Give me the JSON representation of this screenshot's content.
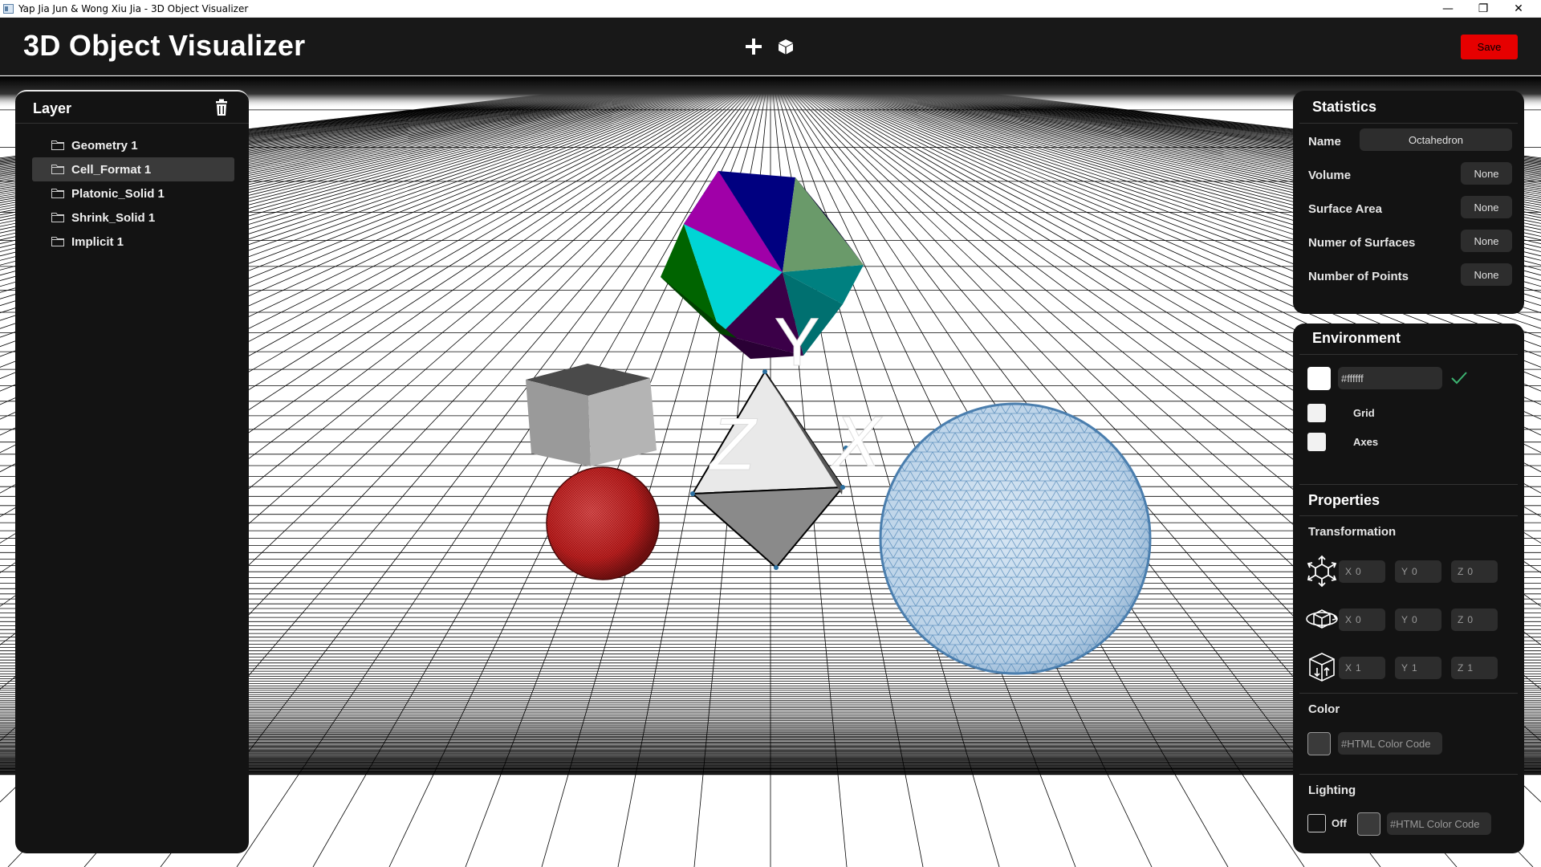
{
  "window": {
    "title": "Yap Jia Jun & Wong Xiu Jia - 3D Object Visualizer",
    "controls": {
      "minimize": "—",
      "maximize": "❐",
      "close": "✕"
    }
  },
  "header": {
    "title": "3D Object Visualizer",
    "icons": [
      "plus-icon",
      "cube-icon"
    ],
    "save_label": "Save",
    "save_color": "#e60000"
  },
  "layer_panel": {
    "title": "Layer",
    "items": [
      {
        "label": "Geometry 1",
        "selected": false
      },
      {
        "label": "Cell_Format 1",
        "selected": true
      },
      {
        "label": "Platonic_Solid 1",
        "selected": false
      },
      {
        "label": "Shrink_Solid 1",
        "selected": false
      },
      {
        "label": "Implicit 1",
        "selected": false
      }
    ]
  },
  "statistics": {
    "title": "Statistics",
    "rows": [
      {
        "label": "Name",
        "value": "Octahedron"
      },
      {
        "label": "Volume",
        "value": "None"
      },
      {
        "label": "Surface Area",
        "value": "None"
      },
      {
        "label": "Numer of Surfaces",
        "value": "None"
      },
      {
        "label": "Number of Points",
        "value": "None"
      }
    ]
  },
  "environment": {
    "title": "Environment",
    "background_color": "#ffffff",
    "color_value": "#ffffff",
    "grid_label": "Grid",
    "axes_label": "Axes"
  },
  "properties": {
    "title": "Properties",
    "transformation_label": "Transformation",
    "translate": {
      "x": "0",
      "y": "0",
      "z": "0"
    },
    "rotate": {
      "x": "0",
      "y": "0",
      "z": "0"
    },
    "scale": {
      "x": "1",
      "y": "1",
      "z": "1"
    },
    "axis_labels": {
      "x": "X",
      "y": "Y",
      "z": "Z"
    },
    "color_label": "Color",
    "color_placeholder": "#HTML Color Code",
    "lighting_label": "Lighting",
    "lighting_off_label": "Off",
    "lighting_placeholder": "#HTML Color Code"
  },
  "scene": {
    "axis_labels": {
      "x": "X",
      "y": "Y",
      "z": "Z"
    },
    "objects": [
      "icosahedron",
      "cube",
      "octahedron",
      "red-sphere",
      "wireframe-sphere"
    ]
  }
}
